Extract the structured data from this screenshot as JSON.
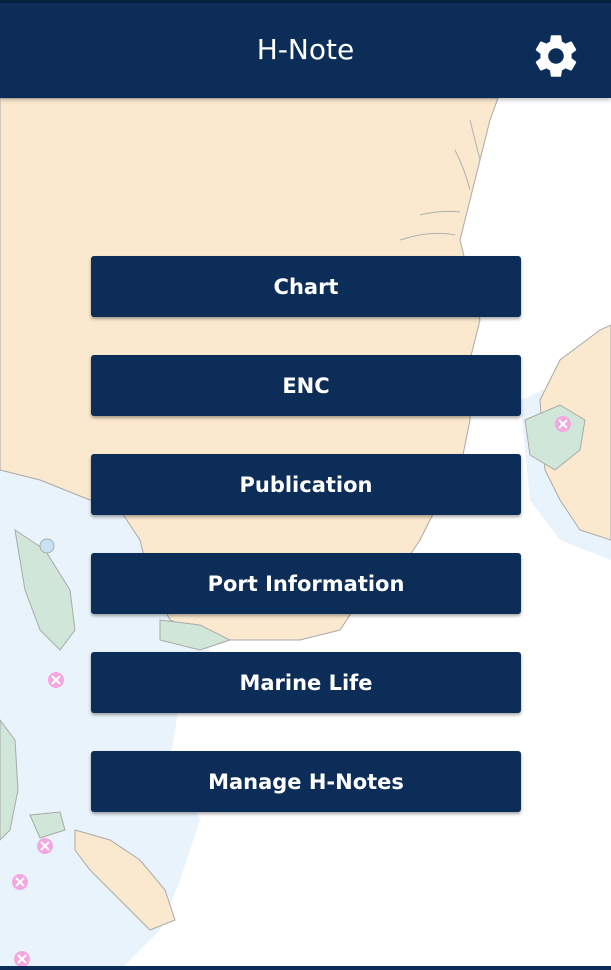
{
  "app_bar": {
    "title": "H-Note",
    "settings_icon": "gear-icon"
  },
  "menu": {
    "items": [
      {
        "label": "Chart"
      },
      {
        "label": "ENC"
      },
      {
        "label": "Publication"
      },
      {
        "label": "Port Information"
      },
      {
        "label": "Marine Life"
      },
      {
        "label": "Manage H-Notes"
      }
    ]
  },
  "colors": {
    "primary": "#0b2d57",
    "land": "#fbe9cf",
    "shallow_water": "#e9f3fb",
    "vegetation": "#cfe6d9",
    "hazard_marker": "#f2a7e0"
  }
}
